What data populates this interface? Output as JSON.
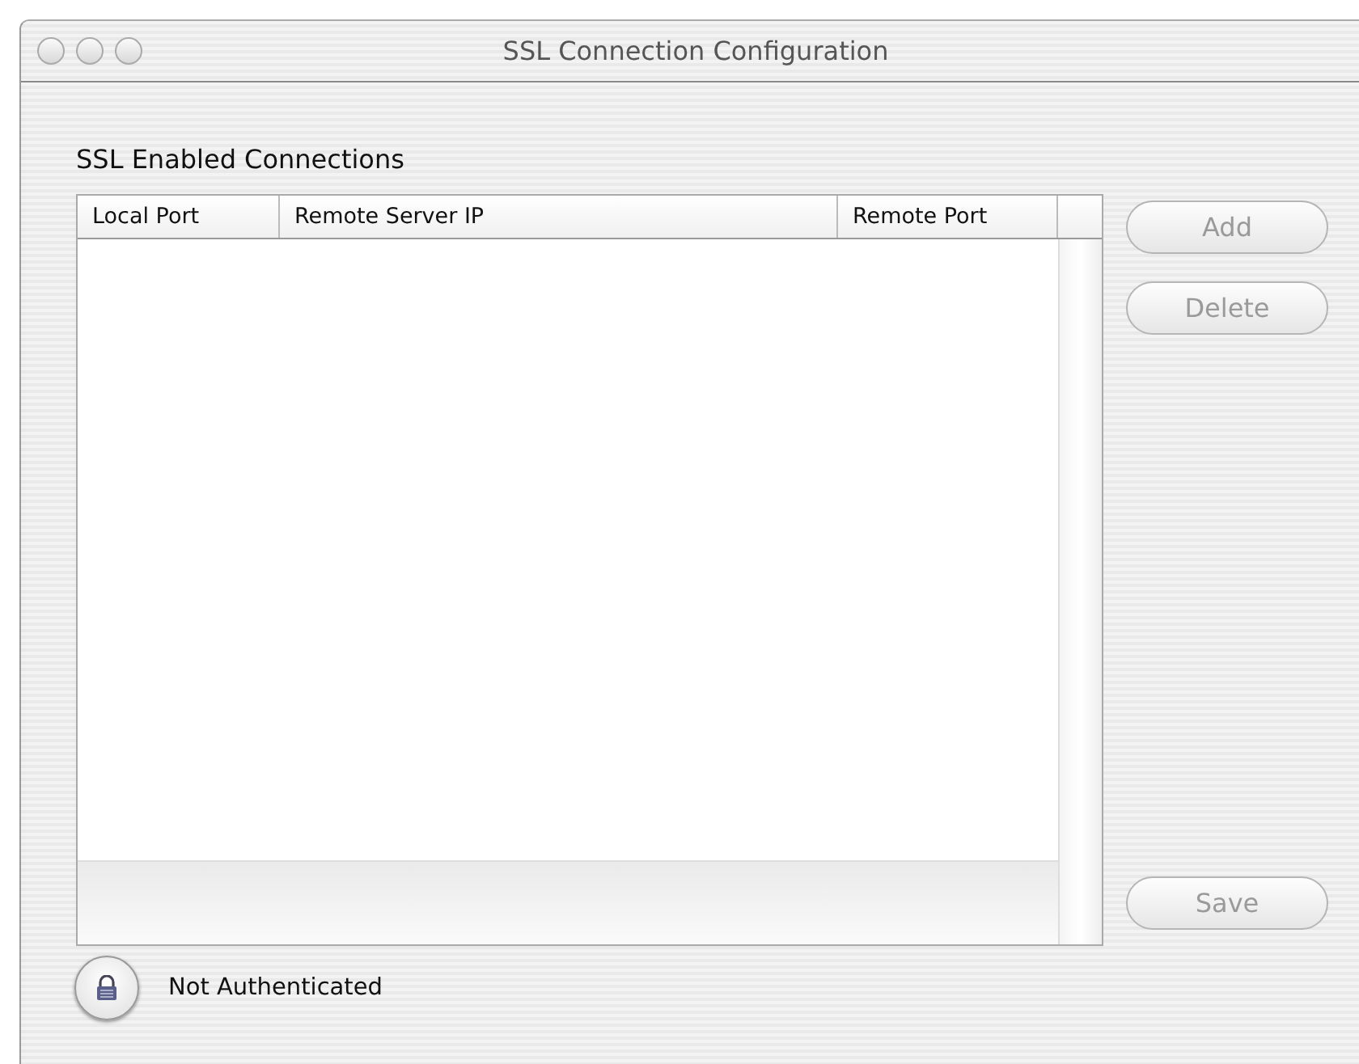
{
  "window": {
    "title": "SSL Connection Configuration"
  },
  "heading": "SSL Enabled Connections",
  "table": {
    "columns": [
      "Local Port",
      "Remote Server IP",
      "Remote Port"
    ]
  },
  "buttons": [
    {
      "label": "Add",
      "disabled": true
    },
    {
      "label": "Delete",
      "disabled": true
    }
  ],
  "save_button": {
    "label": "Save",
    "disabled": true
  },
  "status": {
    "label": "Not Authenticated",
    "locked": true
  }
}
